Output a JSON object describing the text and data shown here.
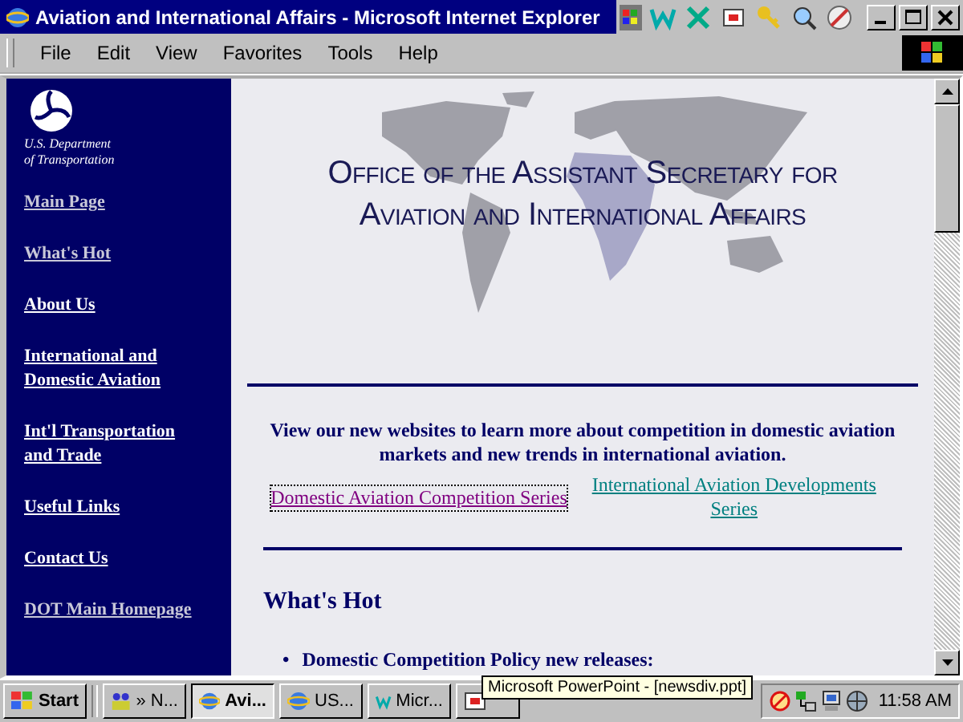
{
  "window": {
    "title": "Aviation and International Affairs - Microsoft Internet Explorer"
  },
  "menu": [
    "File",
    "Edit",
    "View",
    "Favorites",
    "Tools",
    "Help"
  ],
  "sidebar": {
    "logo_caption": [
      "U.S. Department",
      "of Transportation"
    ],
    "items": [
      {
        "label": "Main Page",
        "visited": true
      },
      {
        "label": "What's Hot",
        "visited": true
      },
      {
        "label": "About Us",
        "visited": false
      },
      {
        "label": "International and Domestic Aviation",
        "visited": false
      },
      {
        "label": "Int'l Transportation and Trade",
        "visited": false
      },
      {
        "label": "Useful Links",
        "visited": false
      },
      {
        "label": "Contact Us",
        "visited": false
      },
      {
        "label": "DOT Main Homepage",
        "visited": true
      }
    ]
  },
  "page": {
    "banner": [
      "Office of the Assistant Secretary for",
      "Aviation and International Affairs"
    ],
    "intro": "View our new websites to learn more about competition in domestic aviation markets and new trends in international aviation.",
    "links": [
      {
        "label": "Domestic Aviation Competition Series",
        "visited": true,
        "focused": true
      },
      {
        "label": "International Aviation Developments Series",
        "visited": false,
        "focused": false
      }
    ],
    "section_heading": "What's Hot",
    "bullets": [
      {
        "marker": "•",
        "text": "Domestic Competition Policy new releases:"
      }
    ]
  },
  "taskbar": {
    "start": "Start",
    "buttons": [
      {
        "label": "» N...",
        "selected": false
      },
      {
        "label": "Avi...",
        "selected": true
      },
      {
        "label": "US...",
        "selected": false
      },
      {
        "label": "Micr...",
        "selected": false
      }
    ],
    "tooltip": "Microsoft PowerPoint - [newsdiv.ppt]",
    "clock": "11:58 AM"
  }
}
